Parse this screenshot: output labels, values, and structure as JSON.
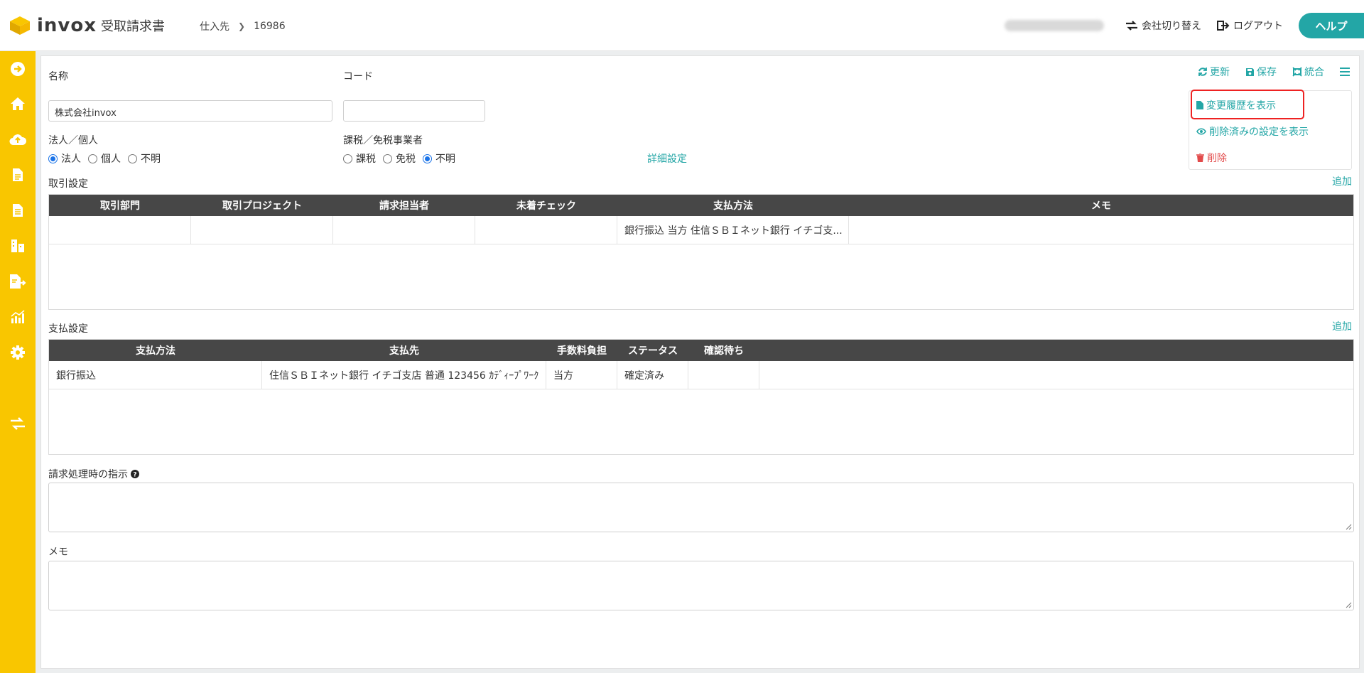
{
  "header": {
    "brand": "invox",
    "brand_sub": "受取請求書",
    "breadcrumb": [
      "仕入先",
      "16986"
    ],
    "switch_company": "会社切り替え",
    "logout": "ログアウト",
    "help": "ヘルプ"
  },
  "sidebar": {
    "icons": [
      "arrow-circle-icon",
      "home-icon",
      "cloud-upload-icon",
      "document-icon",
      "document-list-icon",
      "building-icon",
      "file-export-icon",
      "chart-icon",
      "gear-icon",
      "transfer-icon"
    ]
  },
  "toolbar": {
    "refresh": "更新",
    "save": "保存",
    "merge": "統合",
    "menu_items": {
      "history": "変更履歴を表示",
      "deleted": "削除済みの設定を表示",
      "delete": "削除"
    }
  },
  "form": {
    "name_label": "名称",
    "name_value": "株式会社invox",
    "code_label": "コード",
    "code_value": "",
    "entity_label": "法人／個人",
    "entity_options": [
      "法人",
      "個人",
      "不明"
    ],
    "entity_selected": "法人",
    "tax_label": "課税／免税事業者",
    "tax_options": [
      "課税",
      "免税",
      "不明"
    ],
    "tax_selected": "不明",
    "detail_link": "詳細設定"
  },
  "trade": {
    "title": "取引設定",
    "add": "追加",
    "columns": [
      "取引部門",
      "取引プロジェクト",
      "請求担当者",
      "未着チェック",
      "支払方法",
      "メモ"
    ],
    "rows": [
      [
        "",
        "",
        "",
        "",
        "銀行振込 当方 住信ＳＢＩネット銀行 イチゴ支...",
        ""
      ]
    ]
  },
  "payment": {
    "title": "支払設定",
    "add": "追加",
    "columns": [
      "支払方法",
      "支払先",
      "手数料負担",
      "ステータス",
      "確認待ち",
      ""
    ],
    "rows": [
      [
        "銀行振込",
        "住信ＳＢＩネット銀行 イチゴ支店 普通 123456 ｶﾃﾞｨｰﾌﾟﾜｰｸ",
        "当方",
        "確定済み",
        "",
        ""
      ]
    ]
  },
  "instructions": {
    "label": "請求処理時の指示",
    "value": ""
  },
  "memo": {
    "label": "メモ",
    "value": ""
  },
  "colors": {
    "accent": "#23a6a6",
    "sidebar": "#f9c600",
    "danger": "#e24a4a",
    "table_header": "#474747"
  }
}
